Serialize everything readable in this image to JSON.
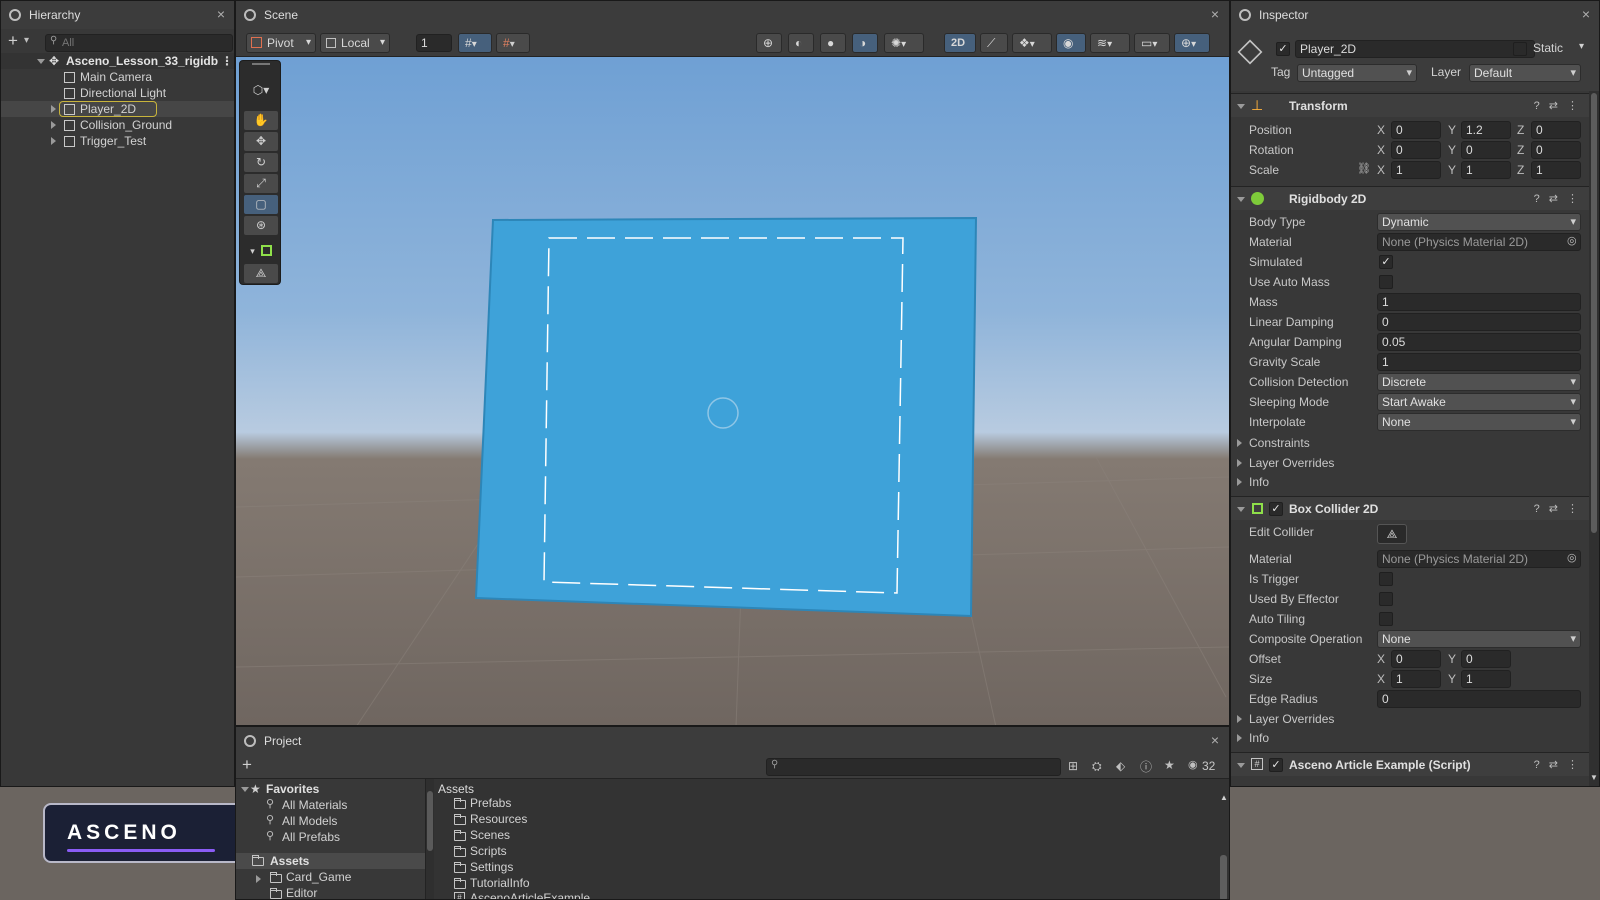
{
  "hierarchy": {
    "tab_label": "Hierarchy",
    "search_placeholder": "All",
    "scene_name": "Asceno_Lesson_33_rigidb",
    "items": [
      {
        "label": "Main Camera"
      },
      {
        "label": "Directional Light"
      },
      {
        "label": "Player_2D"
      },
      {
        "label": "Collision_Ground"
      },
      {
        "label": "Trigger_Test"
      }
    ]
  },
  "scene": {
    "tab_label": "Scene",
    "toolbar": {
      "pivot": "Pivot",
      "space": "Local",
      "grid_value": "1",
      "mode_2d": "2D"
    },
    "sprite_color": "#3ea2d9"
  },
  "project": {
    "tab_label": "Project",
    "hidden_count": "32",
    "favorites_label": "Favorites",
    "favorites": [
      "All Materials",
      "All Models",
      "All Prefabs"
    ],
    "tree_root": "Assets",
    "tree_children": [
      "Card_Game",
      "Editor"
    ],
    "breadcrumb": "Assets",
    "folders": [
      "Prefabs",
      "Resources",
      "Scenes",
      "Scripts",
      "Settings",
      "TutorialInfo"
    ],
    "files": [
      "AscenoArticleExample"
    ]
  },
  "inspector": {
    "tab_label": "Inspector",
    "object_name": "Player_2D",
    "static_label": "Static",
    "tag_label": "Tag",
    "tag_value": "Untagged",
    "layer_label": "Layer",
    "layer_value": "Default",
    "transform": {
      "title": "Transform",
      "position_label": "Position",
      "rotation_label": "Rotation",
      "scale_label": "Scale",
      "position": {
        "x": "0",
        "y": "1.2",
        "z": "0"
      },
      "rotation": {
        "x": "0",
        "y": "0",
        "z": "0"
      },
      "scale": {
        "x": "1",
        "y": "1",
        "z": "1"
      }
    },
    "rigidbody": {
      "title": "Rigidbody 2D",
      "body_type_label": "Body Type",
      "body_type": "Dynamic",
      "material_label": "Material",
      "material": "None (Physics Material 2D)",
      "simulated_label": "Simulated",
      "use_auto_mass_label": "Use Auto Mass",
      "mass_label": "Mass",
      "mass": "1",
      "linear_damping_label": "Linear Damping",
      "linear_damping": "0",
      "angular_damping_label": "Angular Damping",
      "angular_damping": "0.05",
      "gravity_scale_label": "Gravity Scale",
      "gravity_scale": "1",
      "collision_detection_label": "Collision Detection",
      "collision_detection": "Discrete",
      "sleeping_mode_label": "Sleeping Mode",
      "sleeping_mode": "Start Awake",
      "interpolate_label": "Interpolate",
      "interpolate": "None",
      "constraints_label": "Constraints",
      "layer_overrides_label": "Layer Overrides",
      "info_label": "Info"
    },
    "box_collider": {
      "title": "Box Collider 2D",
      "edit_collider_label": "Edit Collider",
      "material_label": "Material",
      "material": "None (Physics Material 2D)",
      "is_trigger_label": "Is Trigger",
      "used_by_effector_label": "Used By Effector",
      "auto_tiling_label": "Auto Tiling",
      "composite_label": "Composite Operation",
      "composite": "None",
      "offset_label": "Offset",
      "offset": {
        "x": "0",
        "y": "0"
      },
      "size_label": "Size",
      "size": {
        "x": "1",
        "y": "1"
      },
      "edge_radius_label": "Edge Radius",
      "edge_radius": "0",
      "layer_overrides_label": "Layer Overrides",
      "info_label": "Info"
    },
    "script": {
      "title": "Asceno Article Example (Script)"
    }
  },
  "brand": {
    "logo_text": "ASCENO"
  },
  "colors": {
    "accent": "#3ea2d9",
    "selection_outline": "#c8b43c",
    "logo_underline": "#8a5cf6"
  }
}
